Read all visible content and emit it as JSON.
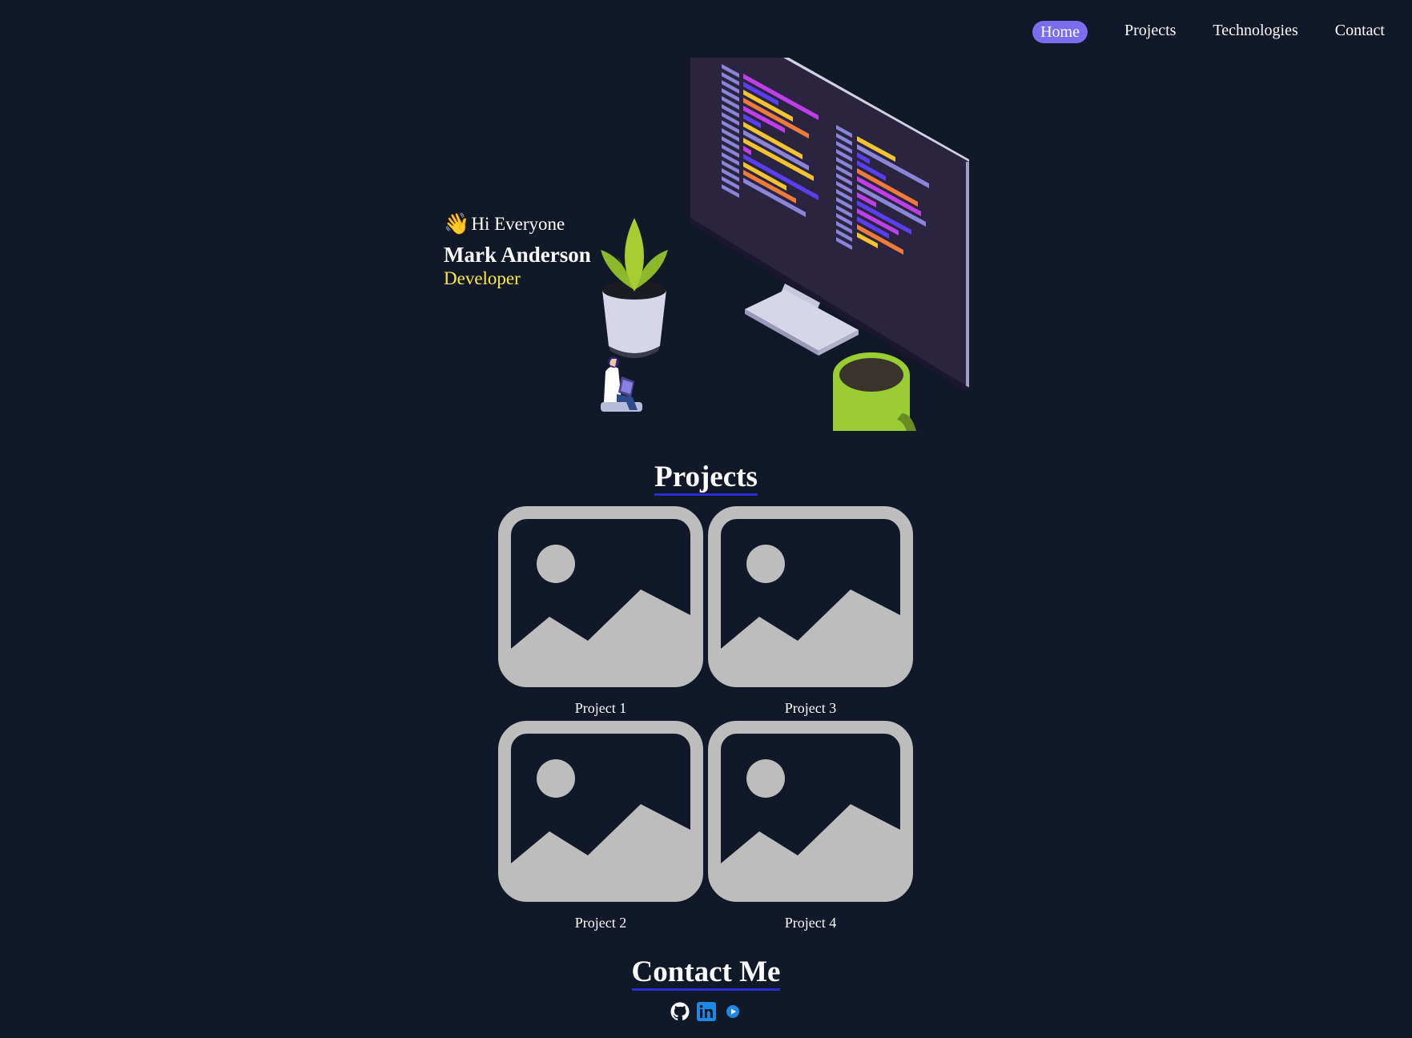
{
  "nav": {
    "items": [
      {
        "label": "Home",
        "active": true
      },
      {
        "label": "Projects",
        "active": false
      },
      {
        "label": "Technologies",
        "active": false
      },
      {
        "label": "Contact",
        "active": false
      }
    ],
    "accent": "#7c6cf0"
  },
  "hero": {
    "wave_icon": "waving-hand-icon",
    "greeting": "Hi Everyone",
    "name": "Mark Anderson",
    "role": "Developer",
    "role_color": "#ffeb3b"
  },
  "projects": {
    "title": "Projects",
    "items": [
      {
        "label": "Project 1"
      },
      {
        "label": "Project 3"
      },
      {
        "label": "Project 2"
      },
      {
        "label": "Project 4"
      }
    ]
  },
  "contact": {
    "title": "Contact Me",
    "socials": [
      {
        "icon": "github-icon"
      },
      {
        "icon": "linkedin-icon"
      },
      {
        "icon": "play-icon"
      }
    ]
  },
  "colors": {
    "background": "#111827",
    "placeholder": "#bdbdbd",
    "underline": "#2b2bd6"
  }
}
